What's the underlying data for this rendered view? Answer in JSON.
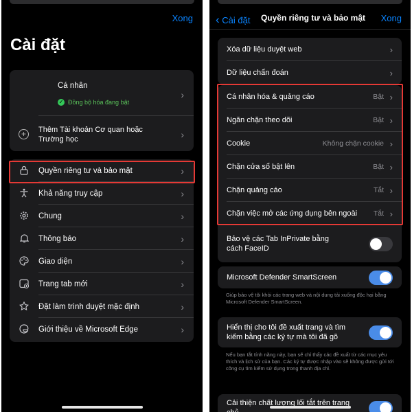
{
  "left": {
    "done": "Xong",
    "title": "Cài đặt",
    "profile": {
      "name": "Cá nhân",
      "sync_status": "Đồng bộ hóa đang bật",
      "add_account": "Thêm Tài khoản Cơ quan hoặc Trường học"
    },
    "menu": [
      {
        "label": "Quyền riêng tư và bảo mật",
        "icon": "lock-icon"
      },
      {
        "label": "Khả năng truy cập",
        "icon": "accessibility-icon"
      },
      {
        "label": "Chung",
        "icon": "gear-icon"
      },
      {
        "label": "Thông báo",
        "icon": "bell-icon"
      },
      {
        "label": "Giao diện",
        "icon": "palette-icon"
      },
      {
        "label": "Trang tab mới",
        "icon": "new-tab-icon"
      },
      {
        "label": "Đặt làm trình duyệt mặc định",
        "icon": "star-browser-icon"
      },
      {
        "label": "Giới thiệu về Microsoft Edge",
        "icon": "edge-logo-icon"
      }
    ]
  },
  "right": {
    "back": "Cài đặt",
    "title": "Quyền riêng tư và bảo mật",
    "done": "Xong",
    "group1": [
      {
        "label": "Xóa dữ liệu duyệt web"
      },
      {
        "label": "Dữ liệu chẩn đoán"
      }
    ],
    "group2": [
      {
        "label": "Cá nhân hóa & quảng cáo",
        "value": "Bật"
      },
      {
        "label": "Ngăn chặn theo dõi",
        "value": "Bật"
      },
      {
        "label": "Cookie",
        "value": "Không chặn cookie"
      },
      {
        "label": "Chặn cửa sổ bật lên",
        "value": "Bật"
      },
      {
        "label": "Chặn quảng cáo",
        "value": "Tắt"
      },
      {
        "label": "Chặn việc mở các ứng dụng bên ngoài",
        "value": "Tắt"
      }
    ],
    "inprivate": {
      "label": "Bảo vệ các Tab InPrivate bằng cách FaceID",
      "on": false
    },
    "smartscreen": {
      "label": "Microsoft Defender SmartScreen",
      "on": true,
      "note": "Giúp bảo vệ tôi khỏi các trang web và nội dung tải xuống độc hại bằng Microsoft Defender SmartScreen."
    },
    "suggestions": {
      "label": "Hiển thị cho tôi đề xuất trang và tìm kiếm bằng các ký tự mà tôi đã gõ",
      "on": true,
      "note": "Nếu bạn tắt tính năng này, bạn sẽ chỉ thấy các đề xuất từ các mục yêu thích và lịch sử của bạn. Các ký tự được nhập vào sẽ không được gửi tới công cụ tìm kiếm sử dụng trong thanh địa chỉ."
    },
    "shortcut": {
      "label": "Cải thiện chất lượng lối tắt trên trang chủ",
      "on": true
    }
  },
  "colors": {
    "accent": "#0a84ff",
    "highlight": "#e53935",
    "toggle_on": "#4a8ce8",
    "sync_green": "#34c759"
  }
}
